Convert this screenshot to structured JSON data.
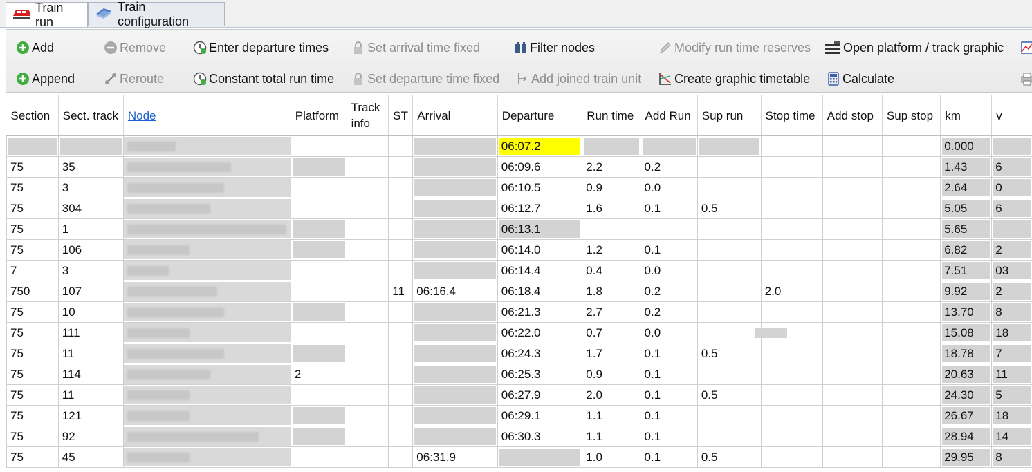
{
  "tabs": [
    {
      "label": "Train run",
      "icon": "train-icon",
      "active": true
    },
    {
      "label": "Train configuration",
      "icon": "train-configuration-icon",
      "active": false
    }
  ],
  "toolbar": {
    "add": "Add",
    "remove": "Remove",
    "enter_departure_times": "Enter departure times",
    "set_arrival_time_fixed": "Set arrival time fixed",
    "filter_nodes": "Filter nodes",
    "modify_run_time_reserves": "Modify run time reserves",
    "open_platform_track_graphic": "Open platform / track graphic",
    "append": "Append",
    "reroute": "Reroute",
    "constant_total_run_time": "Constant total run time",
    "set_departure_time_fixed": "Set departure time fixed",
    "add_joined_train_unit": "Add joined train unit",
    "create_graphic_timetable": "Create graphic timetable",
    "calculate": "Calculate"
  },
  "colors": {
    "highlight": "#ffff00",
    "greyed_cell": "#d3d3d3",
    "link": "#1a5fd0"
  },
  "table": {
    "headers": {
      "section": "Section",
      "sect_track": "Sect. track",
      "node": "Node",
      "platform": "Platform",
      "track_info_1": "Track",
      "track_info_2": "info",
      "st": "ST",
      "arrival": "Arrival",
      "departure": "Departure",
      "run_time": "Run time",
      "add_run": "Add Run",
      "sup_run": "Sup run",
      "stop_time": "Stop time",
      "add_stop": "Add stop",
      "sup_stop": "Sup stop",
      "km": "km",
      "v": "v"
    },
    "rows": [
      {
        "section": "",
        "sect_track": "",
        "platform": "",
        "st": "",
        "arrival": "",
        "departure": "06:07.2",
        "run_time": "",
        "add_run": "",
        "sup_run": "",
        "stop_time": "",
        "km": "0.000",
        "v": ""
      },
      {
        "section": "75",
        "sect_track": "35",
        "platform": "",
        "st": "",
        "arrival": "",
        "departure": "06:09.6",
        "run_time": "2.2",
        "add_run": "0.2",
        "sup_run": "",
        "stop_time": "",
        "km": "1.43",
        "v": "6"
      },
      {
        "section": "75",
        "sect_track": "3",
        "platform": "",
        "st": "",
        "arrival": "",
        "departure": "06:10.5",
        "run_time": "0.9",
        "add_run": "0.0",
        "sup_run": "",
        "stop_time": "",
        "km": "2.64",
        "v": "0"
      },
      {
        "section": "75",
        "sect_track": "304",
        "platform": "",
        "st": "",
        "arrival": "",
        "departure": "06:12.7",
        "run_time": "1.6",
        "add_run": "0.1",
        "sup_run": "0.5",
        "stop_time": "",
        "km": "5.05",
        "v": "6"
      },
      {
        "section": "75",
        "sect_track": "1",
        "platform": "",
        "st": "",
        "arrival": "",
        "departure": "06:13.1",
        "run_time": "",
        "add_run": "",
        "sup_run": "",
        "stop_time": "",
        "km": "5.65",
        "v": ""
      },
      {
        "section": "75",
        "sect_track": "106",
        "platform": "",
        "st": "",
        "arrival": "",
        "departure": "06:14.0",
        "run_time": "1.2",
        "add_run": "0.1",
        "sup_run": "",
        "stop_time": "",
        "km": "6.82",
        "v": "2"
      },
      {
        "section": "7",
        "sect_track": "3",
        "platform": "",
        "st": "",
        "arrival": "",
        "departure": "06:14.4",
        "run_time": "0.4",
        "add_run": "0.0",
        "sup_run": "",
        "stop_time": "",
        "km": "7.51",
        "v": "03"
      },
      {
        "section": "750",
        "sect_track": "107",
        "platform": "",
        "st": "11",
        "arrival": "06:16.4",
        "departure": "06:18.4",
        "run_time": "1.8",
        "add_run": "0.2",
        "sup_run": "",
        "stop_time": "2.0",
        "km": "9.92",
        "v": "2"
      },
      {
        "section": "75",
        "sect_track": "10",
        "platform": "",
        "st": "",
        "arrival": "",
        "departure": "06:21.3",
        "run_time": "2.7",
        "add_run": "0.2",
        "sup_run": "",
        "stop_time": "",
        "km": "13.70",
        "v": "8"
      },
      {
        "section": "75",
        "sect_track": "111",
        "platform": "",
        "st": "",
        "arrival": "",
        "departure": "06:22.0",
        "run_time": "0.7",
        "add_run": "0.0",
        "sup_run": "",
        "stop_time": "",
        "km": "15.08",
        "v": "18"
      },
      {
        "section": "75",
        "sect_track": "11",
        "platform": "",
        "st": "",
        "arrival": "",
        "departure": "06:24.3",
        "run_time": "1.7",
        "add_run": "0.1",
        "sup_run": "0.5",
        "stop_time": "",
        "km": "18.78",
        "v": "7"
      },
      {
        "section": "75",
        "sect_track": "114",
        "platform": "2",
        "st": "",
        "arrival": "",
        "departure": "06:25.3",
        "run_time": "0.9",
        "add_run": "0.1",
        "sup_run": "",
        "stop_time": "",
        "km": "20.63",
        "v": "11"
      },
      {
        "section": "75",
        "sect_track": "11",
        "platform": "",
        "st": "",
        "arrival": "",
        "departure": "06:27.9",
        "run_time": "2.0",
        "add_run": "0.1",
        "sup_run": "0.5",
        "stop_time": "",
        "km": "24.30",
        "v": "5"
      },
      {
        "section": "75",
        "sect_track": "121",
        "platform": "",
        "st": "",
        "arrival": "",
        "departure": "06:29.1",
        "run_time": "1.1",
        "add_run": "0.1",
        "sup_run": "",
        "stop_time": "",
        "km": "26.67",
        "v": "18"
      },
      {
        "section": "75",
        "sect_track": "92",
        "platform": "",
        "st": "",
        "arrival": "",
        "departure": "06:30.3",
        "run_time": "1.1",
        "add_run": "0.1",
        "sup_run": "",
        "stop_time": "",
        "km": "28.94",
        "v": "14"
      },
      {
        "section": "75",
        "sect_track": "45",
        "platform": "",
        "st": "",
        "arrival": "06:31.9",
        "departure": "",
        "run_time": "1.0",
        "add_run": "0.1",
        "sup_run": "0.5",
        "stop_time": "",
        "km": "29.95",
        "v": "8"
      }
    ]
  }
}
